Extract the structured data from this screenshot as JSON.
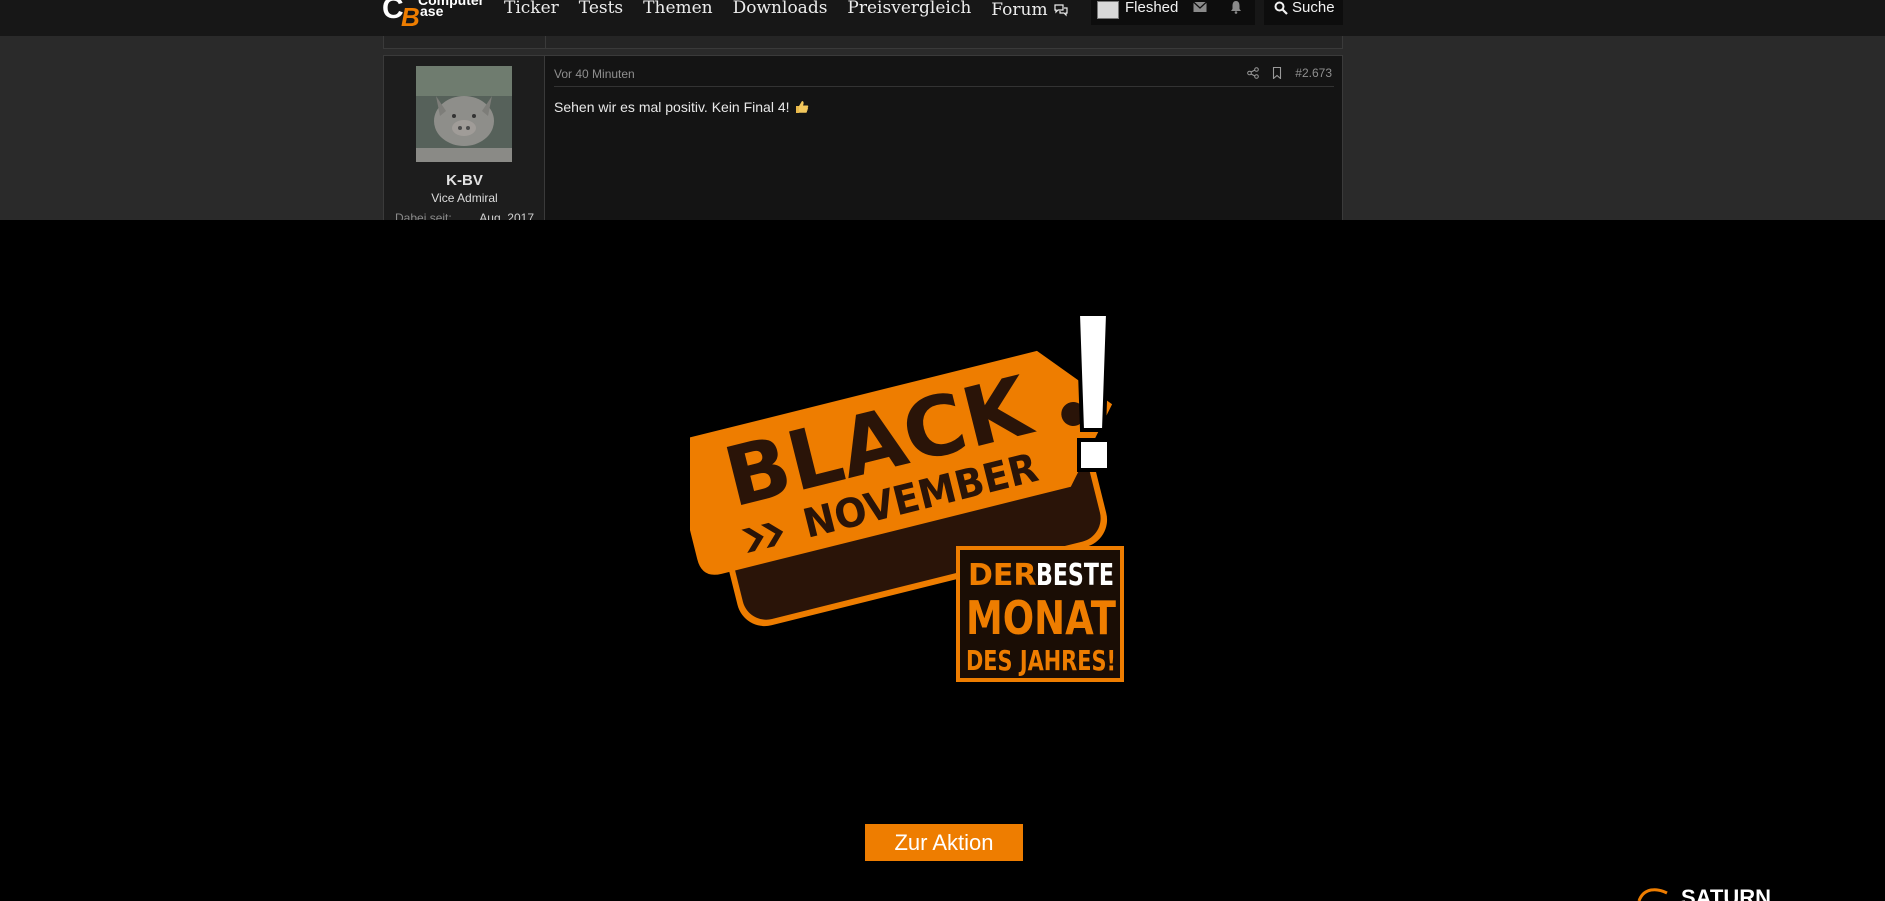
{
  "site": {
    "logo_text_top": "Computer",
    "logo_text_bottom": "Base"
  },
  "nav": {
    "items": [
      "Ticker",
      "Tests",
      "Themen",
      "Downloads",
      "Preisvergleich",
      "Forum"
    ]
  },
  "user": {
    "name": "Fleshed"
  },
  "search": {
    "label": "Suche"
  },
  "post": {
    "username": "K-BV",
    "rank": "Vice Admiral",
    "since_label": "Dabei seit:",
    "since_value": "Aug. 2017",
    "time": "Vor 40 Minuten",
    "number": "#2.673",
    "body": "Sehen wir es mal positiv. Kein Final 4!"
  },
  "ad": {
    "line1": "BLACK",
    "line2": "NOVEMBER",
    "tag_line1_a": "DER",
    "tag_line1_b": "BESTE",
    "tag_line2": "MONAT",
    "tag_line3": "DES JAHRES!",
    "button_label": "Zur Aktion",
    "brand_color": "#ee7d00"
  },
  "colors": {
    "accent": "#ee7d00",
    "nav_bg": "#171717",
    "page_bg": "#2a2a2a",
    "overlay_bg": "#000000"
  }
}
